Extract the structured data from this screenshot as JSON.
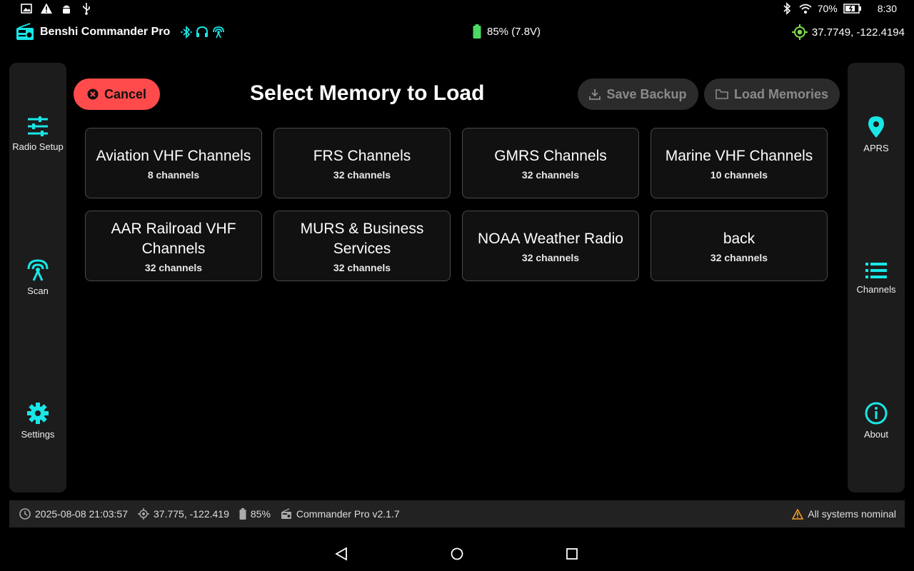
{
  "status_bar": {
    "battery_percent": "70%",
    "time": "8:30",
    "icons": [
      "image-icon",
      "warning-icon",
      "android-icon",
      "usb-icon",
      "bluetooth-icon",
      "wifi-icon",
      "battery-charging-icon"
    ]
  },
  "header": {
    "app_title": "Benshi Commander Pro",
    "battery_text": "85% (7.8V)",
    "gps_text": "37.7749, -122.4194"
  },
  "left_nav": [
    {
      "label": "Radio Setup",
      "icon": "sliders-icon"
    },
    {
      "label": "Scan",
      "icon": "antenna-icon"
    },
    {
      "label": "Settings",
      "icon": "gear-icon"
    }
  ],
  "right_nav": [
    {
      "label": "APRS",
      "icon": "map-pin-icon"
    },
    {
      "label": "Channels",
      "icon": "list-icon"
    },
    {
      "label": "About",
      "icon": "info-icon"
    }
  ],
  "main": {
    "cancel_label": "Cancel",
    "title": "Select Memory to Load",
    "save_backup_label": "Save Backup",
    "load_memories_label": "Load Memories",
    "cards": [
      {
        "title": "Aviation VHF Channels",
        "sub": "8 channels"
      },
      {
        "title": "FRS Channels",
        "sub": "32 channels"
      },
      {
        "title": "GMRS Channels",
        "sub": "32 channels"
      },
      {
        "title": "Marine VHF Channels",
        "sub": "10 channels"
      },
      {
        "title": "AAR Railroad VHF Channels",
        "sub": "32 channels"
      },
      {
        "title": "MURS & Business Services",
        "sub": "32 channels"
      },
      {
        "title": "NOAA Weather Radio",
        "sub": "32 channels"
      },
      {
        "title": "back",
        "sub": "32 channels"
      }
    ]
  },
  "footer": {
    "datetime": "2025-08-08 21:03:57",
    "coords": "37.775, -122.419",
    "battery": "85%",
    "version": "Commander Pro v2.1.7",
    "status": "All systems nominal"
  },
  "colors": {
    "accent": "#19e6e6",
    "cancel": "#ff4b4b",
    "battery_green": "#4cd964",
    "gps_green": "#7be04a",
    "warning": "#f0a020"
  }
}
